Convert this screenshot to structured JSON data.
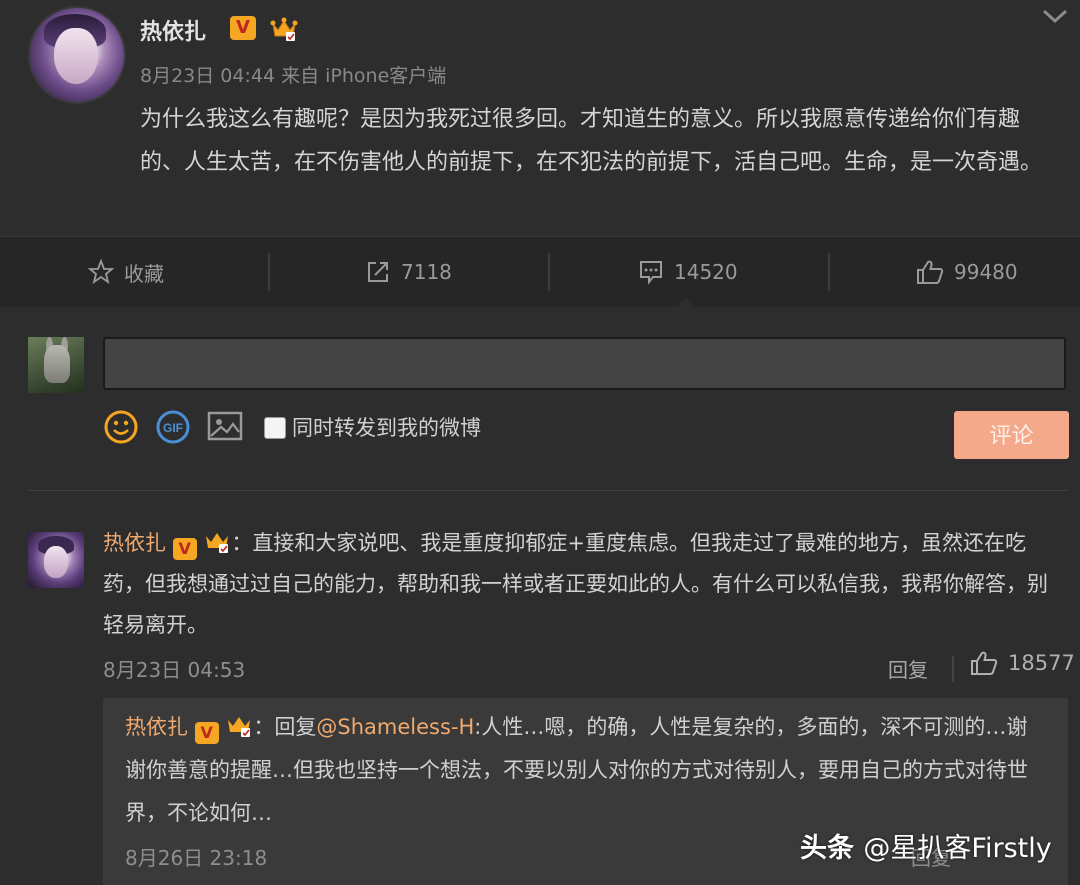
{
  "post": {
    "author": "热依扎",
    "meta": "8月23日 04:44 来自 iPhone客户端",
    "text": "为什么我这么有趣呢？是因为我死过很多回。才知道生的意义。所以我愿意传递给你们有趣的、人生太苦，在不伤害他人的前提下，在不犯法的前提下，活自己吧。生命，是一次奇遇。",
    "verified_badge": "V",
    "crown_badge": "crown-icon"
  },
  "actions": {
    "favorite_label": "收藏",
    "repost_count": "7118",
    "comment_count": "14520",
    "like_count": "99480"
  },
  "compose": {
    "input_value": "",
    "repost_label": "同时转发到我的微博",
    "submit_label": "评论"
  },
  "comment": {
    "author": "热依扎",
    "text": "：直接和大家说吧、我是重度抑郁症+重度焦虑。但我走过了最难的地方，虽然还在吃药，但我想通过过自己的能力，帮助和我一样或者正要如此的人。有什么可以私信我，我帮你解答，别轻易离开。",
    "time": "8月23日 04:53",
    "reply_label": "回复",
    "like_count": "18577"
  },
  "reply": {
    "author": "热依扎",
    "prefix": "：回复",
    "mention": "@Shameless-H",
    "text": ":人性…嗯，的确，人性是复杂的，多面的，深不可测的…谢谢你善意的提醒…但我也坚持一个想法，不要以别人对你的方式对待别人，要用自己的方式对待世界，不论如何…",
    "time": "8月26日 23:18",
    "reply_label": "回复"
  },
  "watermark": {
    "brand": "头条",
    "handle": "@星扒客Firstly"
  },
  "colors": {
    "background": "#2d2d2d",
    "name_accent": "#f0a96e",
    "submit_button": "#f4a98a",
    "badge_gold": "#f5a623"
  }
}
